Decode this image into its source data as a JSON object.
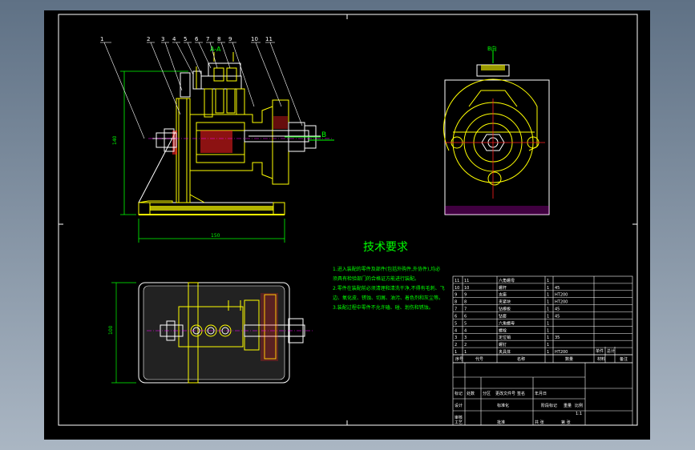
{
  "title": "技术要求",
  "part_numbers": [
    "1",
    "2",
    "3",
    "4",
    "5",
    "6",
    "7",
    "8",
    "9",
    "10",
    "11"
  ],
  "section_label": "A-A",
  "view_label_B": "B",
  "view_label_Bdir": "B向",
  "dim_height": "140",
  "dim_width": "150",
  "dim_plan": "100",
  "requirements": [
    "1.进入装配的零件及部件(包括外购件,外协件),均必",
    "须具有检验部门的合格证方能进行装配。",
    "2.零件在装配前必须清理和清洗干净,不得有毛刺、飞",
    "边、氧化皮、锈蚀、切屑、油污、着色剂和灰尘等。",
    "3.装配过程中零件不允许磕、碰、划伤和锈蚀。"
  ],
  "bom_rows": [
    {
      "no": "11",
      "code": "11",
      "name": "六角螺母",
      "qty": "1",
      "mat": ""
    },
    {
      "no": "10",
      "code": "10",
      "name": "螺杆",
      "qty": "1",
      "mat": "45"
    },
    {
      "no": "9",
      "code": "9",
      "name": "支座",
      "qty": "1",
      "mat": "HT200"
    },
    {
      "no": "8",
      "code": "8",
      "name": "夹紧块",
      "qty": "1",
      "mat": "HT200"
    },
    {
      "no": "7",
      "code": "7",
      "name": "钻模板",
      "qty": "1",
      "mat": "45"
    },
    {
      "no": "6",
      "code": "6",
      "name": "钻套",
      "qty": "1",
      "mat": "45"
    },
    {
      "no": "5",
      "code": "5",
      "name": "六角螺母",
      "qty": "1",
      "mat": ""
    },
    {
      "no": "4",
      "code": "4",
      "name": "螺栓",
      "qty": "1",
      "mat": ""
    },
    {
      "no": "3",
      "code": "3",
      "name": "定位销",
      "qty": "1",
      "mat": "35"
    },
    {
      "no": "2",
      "code": "2",
      "name": "螺钉",
      "qty": "1",
      "mat": ""
    },
    {
      "no": "1",
      "code": "1",
      "name": "夹具体",
      "qty": "1",
      "mat": "HT200"
    }
  ],
  "bom_header": {
    "no": "序号",
    "code": "代号",
    "name": "名称",
    "qty": "数量",
    "mat": "材料",
    "weight": "单件",
    "total": "总计",
    "note": "备注"
  },
  "title_block": {
    "rows": [
      "标记",
      "处数",
      "分区",
      "更改文件号",
      "签名",
      "年月日"
    ],
    "design": "设计",
    "standard": "标准化",
    "stage": "阶段标记",
    "weight": "重量",
    "scale": "比例",
    "scale_val": "1:1",
    "audit": "审核",
    "craft": "工艺",
    "approve": "批准",
    "sheet_total": "共 张",
    "sheet_no": "第 张"
  },
  "colors": {
    "white": "#ffffff",
    "yellow": "#ffff00",
    "green": "#00ff00",
    "red": "#ff2020",
    "magenta": "#ff00ff",
    "cyan": "#00ffff",
    "tb_lines": "#ffffff"
  }
}
